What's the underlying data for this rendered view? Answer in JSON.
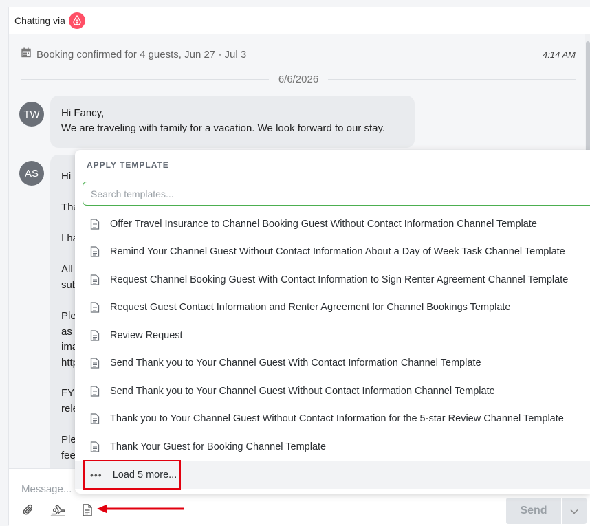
{
  "header": {
    "chatting_via": "Chatting via",
    "channel_icon": "airbnb-icon"
  },
  "booking": {
    "text": "Booking confirmed for 4 guests, Jun 27 - Jul 3",
    "time": "4:14 AM"
  },
  "date_separator": "6/6/2026",
  "messages": [
    {
      "initials": "TW",
      "lines": [
        "Hi Fancy,",
        "We are traveling with family for a vacation.  We look forward to our stay."
      ]
    },
    {
      "initials": "AS",
      "lines": [
        "Hi",
        "Tha",
        "I ha",
        "All",
        "sub",
        "Ple",
        "as",
        "ima",
        "http",
        "FY",
        "rele",
        "Ple",
        "fee"
      ]
    }
  ],
  "composer": {
    "placeholder": "Message...",
    "send_label": "Send"
  },
  "template_popup": {
    "title": "APPLY TEMPLATE",
    "search_placeholder": "Search templates...",
    "items": [
      "Offer Travel Insurance to Channel Booking Guest Without Contact Information Channel Template",
      "Remind Your Channel Guest Without Contact Information About a Day of Week Task Channel Template",
      "Request Channel Booking Guest With Contact Information to Sign Renter Agreement Channel Template",
      "Request Guest Contact Information and Renter Agreement for Channel Bookings Template",
      "Review Request",
      "Send Thank you to Your Channel Guest With Contact Information Channel Template",
      "Send Thank you to Your Channel Guest Without Contact Information Channel Template",
      "Thank you to Your Channel Guest Without Contact Information for the 5-star Review Channel Template",
      "Thank Your Guest for Booking Channel Template"
    ],
    "load_more_dots": "•••",
    "load_more": "Load 5 more..."
  },
  "colors": {
    "airbnb": "#ff4f66",
    "search_border": "#4caf50",
    "annotation": "#e2000f"
  }
}
